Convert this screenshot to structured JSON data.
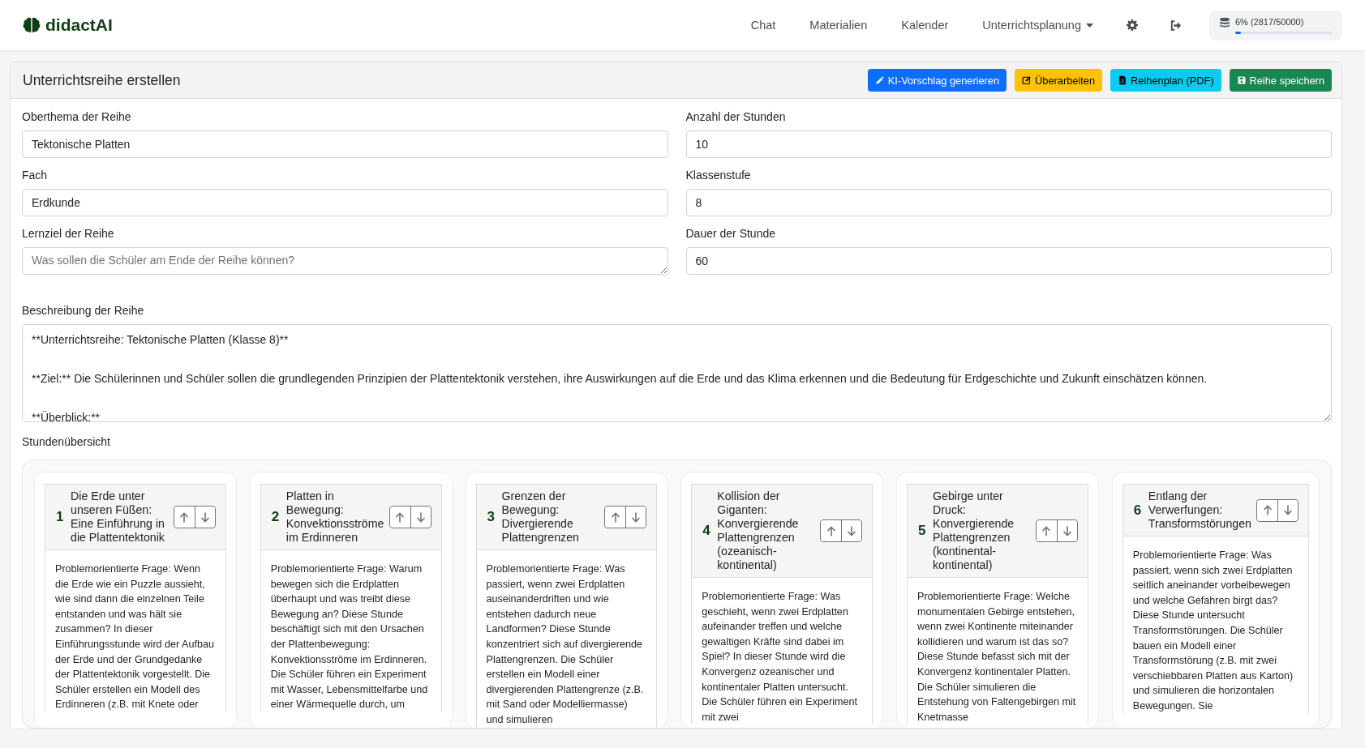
{
  "brand": "didactAI",
  "nav": [
    {
      "label": "Chat",
      "kind": "link"
    },
    {
      "label": "Materialien",
      "kind": "link"
    },
    {
      "label": "Kalender",
      "kind": "link"
    },
    {
      "label": "Unterrichtsplanung",
      "kind": "dropdown"
    },
    {
      "kind": "settings"
    },
    {
      "kind": "logout"
    }
  ],
  "tokens": {
    "reading": "6% (2817/50000)",
    "level": 0.06
  },
  "panel": {
    "title": "Unterrichtsreihe erstellen",
    "buttons": [
      {
        "label": "KI-Vorschlag generieren",
        "kind": "primary"
      },
      {
        "label": "Überarbeiten",
        "kind": "warning"
      },
      {
        "label": "Reihenplan (PDF)",
        "kind": "info"
      },
      {
        "label": "Reihe speichern",
        "kind": "success"
      }
    ]
  },
  "fields": [
    {
      "label": "Oberthema der Reihe",
      "value": "Tektonische Platten",
      "kind": "input"
    },
    {
      "label": "Anzahl der Stunden",
      "value": "10",
      "kind": "input"
    },
    {
      "label": "Fach",
      "value": "Erdkunde",
      "kind": "input"
    },
    {
      "label": "Klassenstufe",
      "value": "8",
      "kind": "input"
    },
    {
      "label": "Lernziel der Reihe",
      "placeholder": "Was sollen die Schüler am Ende der Reihe können?",
      "kind": "textarea"
    },
    {
      "label": "Dauer der Stunde",
      "value": "60",
      "kind": "input"
    }
  ],
  "description": {
    "label": "Beschreibung der Reihe",
    "value": "**Unterrichtsreihe: Tektonische Platten (Klasse 8)**\n\n**Ziel:** Die Schülerinnen und Schüler sollen die grundlegenden Prinzipien der Plattentektonik verstehen, ihre Auswirkungen auf die Erde und das Klima erkennen und die Bedeutung für Erdgeschichte und Zukunft einschätzen können.\n\n**Überblick:**"
  },
  "lessons_label": "Stundenübersicht",
  "lessons": [
    {
      "number": "1",
      "title": "Die Erde unter unseren Füßen: Eine Einführung in die Plattentektonik",
      "text": "Problemorientierte Frage: Wenn die Erde wie ein Puzzle aussieht, wie sind dann die einzelnen Teile entstanden und was hält sie zusammen? In dieser Einführungsstunde wird der Aufbau der Erde und der Grundgedanke der Plattentektonik vorgestellt. Die Schüler erstellen ein Modell des Erdinneren (z.B. mit Knete oder"
    },
    {
      "number": "2",
      "title": "Platten in Bewegung: Konvektionsströme im Erdinneren",
      "text": "Problemorientierte Frage: Warum bewegen sich die Erdplatten überhaupt und was treibt diese Bewegung an? Diese Stunde beschäftigt sich mit den Ursachen der Plattenbewegung: Konvektionsströme im Erdinneren. Die Schüler führen ein Experiment mit Wasser, Lebensmittelfarbe und einer Wärmequelle durch, um"
    },
    {
      "number": "3",
      "title": "Grenzen der Bewegung: Divergierende Plattengrenzen",
      "text": "Problemorientierte Frage: Was passiert, wenn zwei Erdplatten auseinanderdriften und wie entstehen dadurch neue Landformen? Diese Stunde konzentriert sich auf divergierende Plattengrenzen. Die Schüler erstellen ein Modell einer divergierenden Plattengrenze (z.B. mit Sand oder Modelliermasse) und simulieren"
    },
    {
      "number": "4",
      "title": "Kollision der Giganten: Konvergierende Plattengrenzen (ozeanisch-kontinental)",
      "text": "Problemorientierte Frage: Was geschieht, wenn zwei Erdplatten aufeinander treffen und welche gewaltigen Kräfte sind dabei im Spiel? In dieser Stunde wird die Konvergenz ozeanischer und kontinentaler Platten untersucht. Die Schüler führen ein Experiment mit zwei"
    },
    {
      "number": "5",
      "title": "Gebirge unter Druck: Konvergierende Plattengrenzen (kontinental-kontinental)",
      "text": "Problemorientierte Frage: Welche monumentalen Gebirge entstehen, wenn zwei Kontinente miteinander kollidieren und warum ist das so? Diese Stunde befasst sich mit der Konvergenz kontinentaler Platten. Die Schüler simulieren die Entstehung von Faltengebirgen mit Knetmasse"
    },
    {
      "number": "6",
      "title": "Entlang der Verwerfungen: Transformstörungen",
      "text": "Problemorientierte Frage: Was passiert, wenn sich zwei Erdplatten seitlich aneinander vorbeibewegen und welche Gefahren birgt das? Diese Stunde untersucht Transformstörungen. Die Schüler bauen ein Modell einer Transformstörung (z.B. mit zwei verschiebbaren Platten aus Karton) und simulieren die horizontalen Bewegungen. Sie"
    }
  ]
}
